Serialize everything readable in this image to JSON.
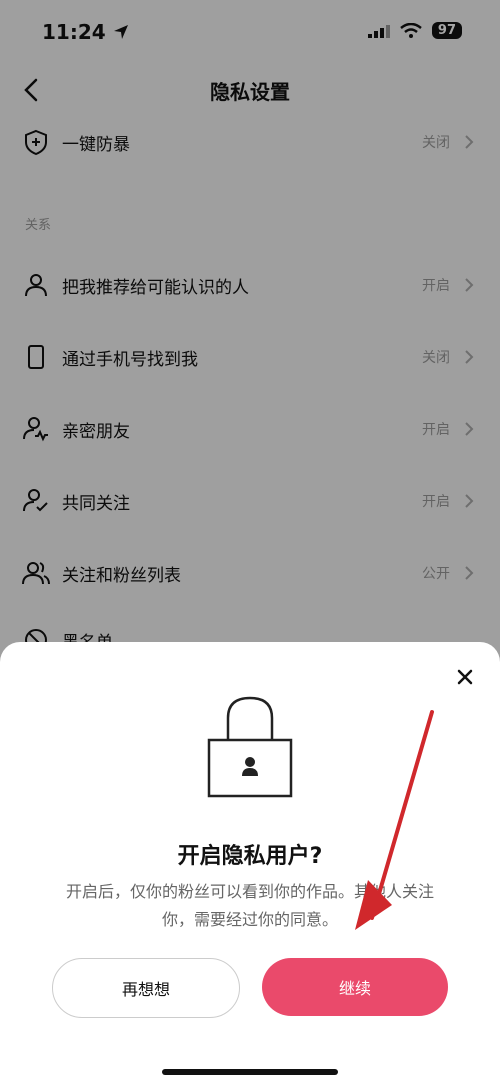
{
  "status_bar": {
    "time": "11:24",
    "battery": "97"
  },
  "nav": {
    "title": "隐私设置"
  },
  "rows_top": [
    {
      "label": "一键防暴",
      "value": "关闭"
    }
  ],
  "section": {
    "title": "关系"
  },
  "rows": [
    {
      "label": "把我推荐给可能认识的人",
      "value": "开启"
    },
    {
      "label": "通过手机号找到我",
      "value": "关闭"
    },
    {
      "label": "亲密朋友",
      "value": "开启"
    },
    {
      "label": "共同关注",
      "value": "开启"
    },
    {
      "label": "关注和粉丝列表",
      "value": "公开"
    },
    {
      "label": "黑名单",
      "value": ""
    }
  ],
  "dialog": {
    "title": "开启隐私用户?",
    "description": "开启后，仅你的粉丝可以看到你的作品。其他人关注你，需要经过你的同意。",
    "cancel_label": "再想想",
    "confirm_label": "继续"
  },
  "colors": {
    "primary": "#ea4a6b",
    "annotation_arrow": "#d0282c"
  }
}
